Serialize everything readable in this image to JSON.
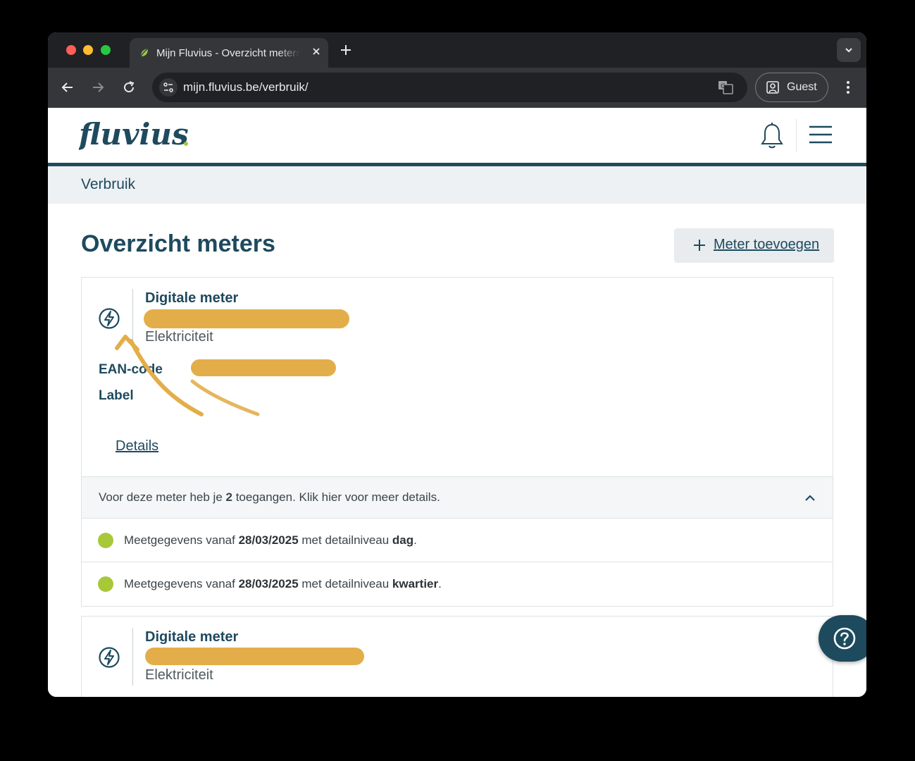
{
  "browser": {
    "tab_title": "Mijn Fluvius - Overzicht meters",
    "url_host": "mijn.fluvius.be",
    "url_path": "/verbruik/",
    "profile_label": "Guest"
  },
  "header": {
    "logo_text": "fluvius"
  },
  "breadcrumb": "Verbruik",
  "page_title": "Overzicht meters",
  "add_button_label": "Meter toevoegen",
  "meters": [
    {
      "type": "Digitale meter",
      "kind": "Elektriciteit",
      "ean_label": "EAN-code",
      "label_label": "Label",
      "details_link": "Details",
      "access_summary_prefix": "Voor deze meter heb je ",
      "access_count": "2",
      "access_summary_suffix": " toegangen. Klik hier voor meer details.",
      "accesses": [
        {
          "prefix": "Meetgegevens vanaf ",
          "date": "28/03/2025",
          "middle": " met detailniveau ",
          "level": "dag",
          "suffix": "."
        },
        {
          "prefix": "Meetgegevens vanaf ",
          "date": "28/03/2025",
          "middle": " met detailniveau ",
          "level": "kwartier",
          "suffix": "."
        }
      ]
    },
    {
      "type": "Digitale meter",
      "kind": "Elektriciteit"
    }
  ],
  "colors": {
    "brand_dark": "#1e4a5e",
    "brand_lime": "#a8c83a",
    "redaction": "#e3ae4a"
  }
}
